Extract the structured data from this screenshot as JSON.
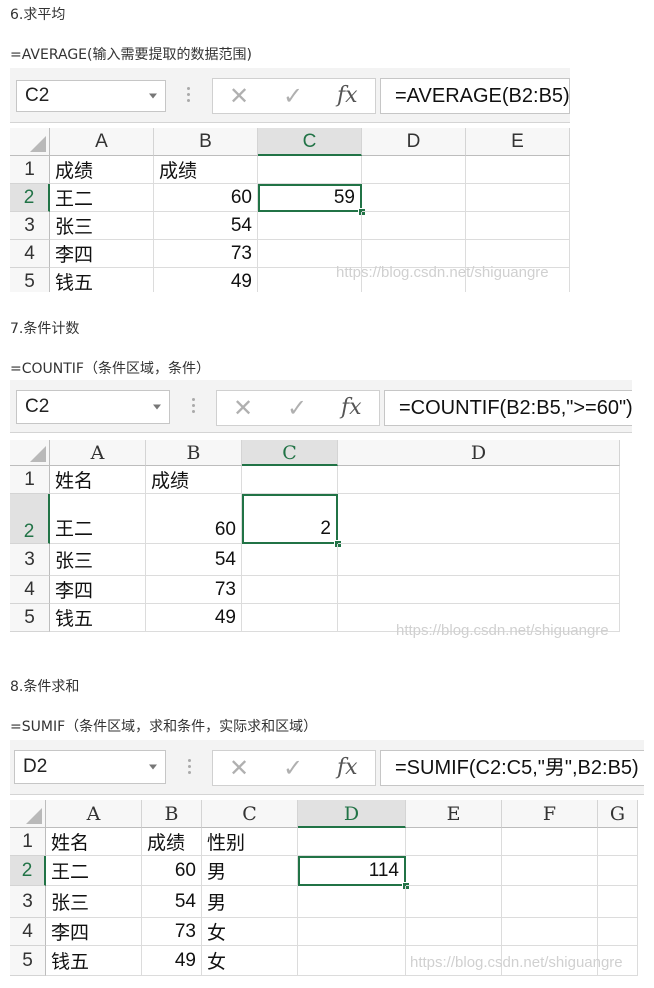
{
  "sections": [
    {
      "heading": "6.求平均",
      "syntax": "=AVERAGE(输入需要提取的数据范围)",
      "name_box": "C2",
      "formula": "=AVERAGE(B2:B5)",
      "columns": [
        "A",
        "B",
        "C",
        "D",
        "E"
      ],
      "rows": [
        {
          "num": "1",
          "cells": [
            "成绩",
            "成绩",
            "",
            "",
            ""
          ]
        },
        {
          "num": "2",
          "cells": [
            "王二",
            "60",
            "59",
            "",
            ""
          ]
        },
        {
          "num": "3",
          "cells": [
            "张三",
            "54",
            "",
            "",
            ""
          ]
        },
        {
          "num": "4",
          "cells": [
            "李四",
            "73",
            "",
            "",
            ""
          ]
        },
        {
          "num": "5",
          "cells": [
            "钱五",
            "49",
            "",
            "",
            ""
          ]
        }
      ],
      "watermark": "https://blog.csdn.net/shiguangre"
    },
    {
      "heading": "7.条件计数",
      "syntax": "=COUNTIF（条件区域，条件）",
      "name_box": "C2",
      "formula": "=COUNTIF(B2:B5,\">=60\")",
      "columns": [
        "A",
        "B",
        "C",
        "D"
      ],
      "rows": [
        {
          "num": "1",
          "cells": [
            "姓名",
            "成绩",
            "",
            ""
          ]
        },
        {
          "num": "2",
          "cells": [
            "王二",
            "60",
            "2",
            ""
          ]
        },
        {
          "num": "3",
          "cells": [
            "张三",
            "54",
            "",
            ""
          ]
        },
        {
          "num": "4",
          "cells": [
            "李四",
            "73",
            "",
            ""
          ]
        },
        {
          "num": "5",
          "cells": [
            "钱五",
            "49",
            "",
            ""
          ]
        }
      ],
      "watermark": "https://blog.csdn.net/shiguangre"
    },
    {
      "heading": "8.条件求和",
      "syntax": "=SUMIF（条件区域，求和条件，实际求和区域）",
      "name_box": "D2",
      "formula": "=SUMIF(C2:C5,\"男\",B2:B5)",
      "columns": [
        "A",
        "B",
        "C",
        "D",
        "E",
        "F",
        "G"
      ],
      "rows": [
        {
          "num": "1",
          "cells": [
            "姓名",
            "成绩",
            "性别",
            "",
            "",
            "",
            ""
          ]
        },
        {
          "num": "2",
          "cells": [
            "王二",
            "60",
            "男",
            "114",
            "",
            "",
            ""
          ]
        },
        {
          "num": "3",
          "cells": [
            "张三",
            "54",
            "男",
            "",
            "",
            "",
            ""
          ]
        },
        {
          "num": "4",
          "cells": [
            "李四",
            "73",
            "女",
            "",
            "",
            "",
            ""
          ]
        },
        {
          "num": "5",
          "cells": [
            "钱五",
            "49",
            "女",
            "",
            "",
            "",
            ""
          ]
        }
      ],
      "watermark": "https://blog.csdn.net/shiguangre"
    }
  ],
  "icons": {
    "cancel": "cancel-x-icon",
    "confirm": "confirm-check-icon",
    "function": "fx-icon",
    "dropdown": "chevron-down-icon"
  },
  "colors": {
    "accent": "#217346"
  }
}
